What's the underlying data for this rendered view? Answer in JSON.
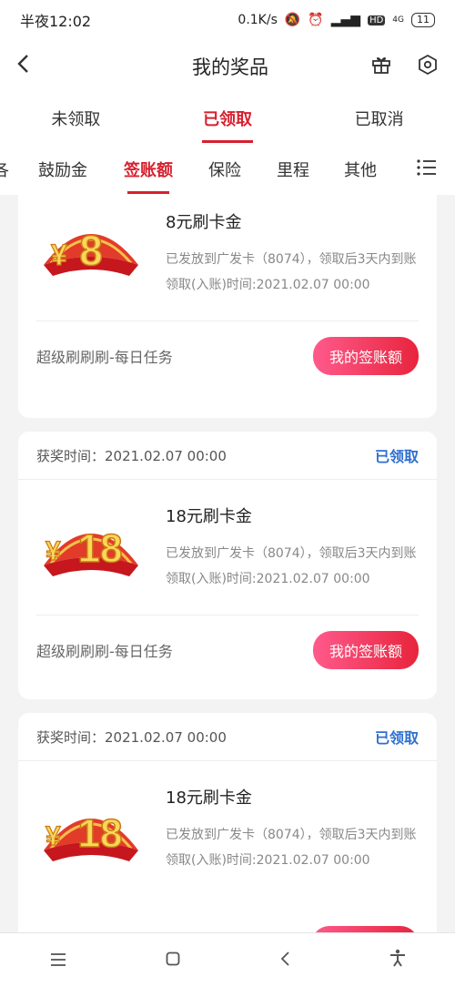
{
  "status_bar": {
    "time": "半夜12:02",
    "network_speed": "0.1K/s",
    "signal_label": "4G",
    "hd_label": "HD",
    "battery": "11"
  },
  "header": {
    "title": "我的奖品",
    "back_icon": "back-arrow-icon",
    "gift_icon": "gift-icon",
    "settings_icon": "hexagon-settings-icon"
  },
  "top_tabs": [
    {
      "label": "未领取"
    },
    {
      "label": "已领取",
      "active": true
    },
    {
      "label": "已取消"
    }
  ],
  "sub_tabs": [
    {
      "label": "鼓励金"
    },
    {
      "label": "签账额",
      "active": true
    },
    {
      "label": "保险"
    },
    {
      "label": "里程"
    },
    {
      "label": "其他"
    }
  ],
  "sub_tabs_partial": "各",
  "cards": [
    {
      "amount": "8",
      "name": "8元刷卡金",
      "desc": "已发放到广发卡（8074），领取后3天内到账",
      "time": "领取(入账)时间:2021.02.07 00:00",
      "task": "超级刷刷刷-每日任务",
      "button": "我的签账额"
    },
    {
      "award_time": "获奖时间：2021.02.07 00:00",
      "status": "已领取",
      "amount": "18",
      "name": "18元刷卡金",
      "desc": "已发放到广发卡（8074），领取后3天内到账",
      "time": "领取(入账)时间:2021.02.07 00:00",
      "task": "超级刷刷刷-每日任务",
      "button": "我的签账额"
    },
    {
      "award_time": "获奖时间：2021.02.07 00:00",
      "status": "已领取",
      "amount": "18",
      "name": "18元刷卡金",
      "desc": "已发放到广发卡（8074），领取后3天内到账",
      "time": "领取(入账)时间:2021.02.07 00:00"
    }
  ],
  "colors": {
    "accent": "#d8202f",
    "claimed": "#2e6fcf",
    "button_start": "#ff5a8c",
    "button_end": "#e8243c"
  }
}
